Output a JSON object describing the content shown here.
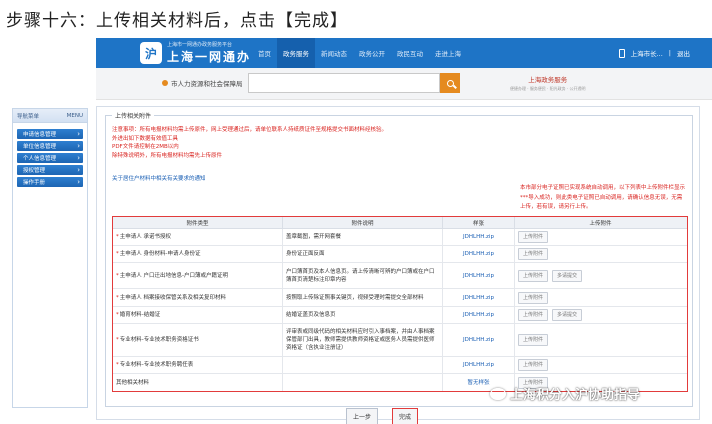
{
  "step_title": "步骤十六：上传相关材料后，点击【完成】",
  "header": {
    "logo_sub": "上海市一网通办政务服务平台",
    "logo_main": "上海一网通办",
    "nav": [
      "首页",
      "政务服务",
      "新闻动态",
      "政务公开",
      "政民互动",
      "走进上海"
    ],
    "right": [
      "上海市长...",
      "|",
      "退出"
    ]
  },
  "searchbar": {
    "location": "市人力资源和社会保障局",
    "placeholder": "",
    "brand_main": "上海政务服务",
    "brand_sub": "便捷办理 · 服务便民 · 阳光政务 · 公开透明"
  },
  "sidebar": {
    "title": "导航菜单",
    "title_right": "MENU",
    "items": [
      "申请信息管理",
      "单位信息管理",
      "个人信息管理",
      "授权管理",
      "操作手册"
    ]
  },
  "panel": {
    "legend": "上传相关附件",
    "notes": [
      "注意事项：所有电报材料均需上传原件，网上受理通过后，请单位联系人持纸质证件至规格提交书面材料经核验。",
      "外进出如下数据有效值工具",
      "PDF文件请控制在2MB以内",
      "除特殊说明外，所有电报材料均需先上传原件"
    ],
    "link": "关于居住户材料中相关有关要求的通知",
    "right_note": "本市部分电子证照已实现系统自动调用，以下列表中上传附件栏显示***导入成功，则此类电子证照已自动调用，请确认信息无误，无需上传，若有误，请另行上传。"
  },
  "table": {
    "headers": [
      "附件类型",
      "附件说明",
      "样张",
      "上传附件"
    ],
    "rows": [
      {
        "name": "主申请人 承诺书授权",
        "desc": "盖章截图，需开网套餐",
        "file": "JDHLHH.zip",
        "ops": [
          "上传附件"
        ]
      },
      {
        "name": "主申请人 身份材料-申请人身份证",
        "desc": "身份证正面反面",
        "file": "JDHLHH.zip",
        "ops": [
          "上传附件"
        ]
      },
      {
        "name": "主申请人 户口迁出地信息-户口薄或户籍证明",
        "desc": "户口簿首页及本人信息页。请上传清晰可辨的户口簿或在户口簿首页清楚标注印章内容",
        "file": "JDHLHH.zip",
        "ops": [
          "上传附件",
          "多请提交"
        ]
      },
      {
        "name": "主申请人 档案接收保管关系及相关复印材料",
        "desc": "按照取上传除证照事关键页，视频受理时需提交全部材料",
        "file": "JDHLHH.zip",
        "ops": [
          "上传附件"
        ]
      },
      {
        "name": "婚育材料-结婚证",
        "desc": "结婚证盖页及信息页",
        "file": "JDHLHH.zip",
        "ops": [
          "上传附件",
          "多请提交"
        ]
      },
      {
        "name": "专业材料-专业技术职务资格证书",
        "desc": "评审表或同级代码的相关材料应时引入事档案，并由人事档案保管部门出具，教师需提供教师资格证或医务人员需提供医师资格证（含执业注册证）",
        "file": "JDHLHH.zip",
        "ops": [
          "上传附件"
        ]
      },
      {
        "name": "专业材料-专业技术职务聘任表",
        "desc": "",
        "file": "JDHLHH.zip",
        "ops": [
          "上传附件"
        ]
      },
      {
        "name": "其他相关材料",
        "desc": "",
        "file": "暂无样张",
        "ops": [
          "上传附件"
        ]
      }
    ]
  },
  "buttons": {
    "prev": "上一步",
    "finish": "完成"
  },
  "watermark": "上海积分入沪协助指导",
  "colors": {
    "brand_blue": "#1e74c6",
    "highlight_red": "#e23b3b",
    "note_red": "#d9231f",
    "search_orange": "#e58a1f"
  }
}
